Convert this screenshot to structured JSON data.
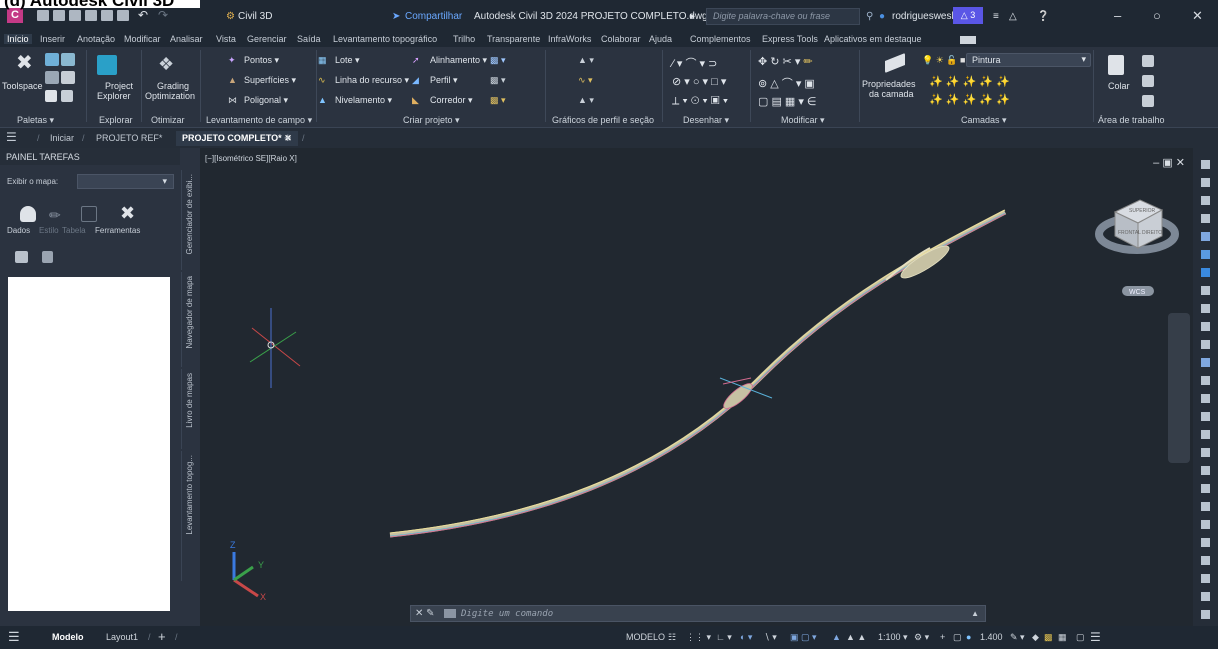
{
  "caption": "(d) Autodesk Civil 3D",
  "titlebar": {
    "workspace": "Civil 3D",
    "share": "Compartilhar",
    "title": "Autodesk Civil 3D 2024   PROJETO COMPLETO.dwg",
    "search_placeholder": "Digite palavra-chave ou frase",
    "user": "rodrigueswesl...",
    "alerts": "3"
  },
  "menu": [
    "Início",
    "Inserir",
    "Anotação",
    "Modificar",
    "Analisar",
    "Vista",
    "Gerenciar",
    "Saída",
    "Levantamento topográfico",
    "Trilho",
    "Transparente",
    "InfraWorks",
    "Colaborar",
    "Ajuda",
    "Complementos",
    "Express Tools",
    "Aplicativos em destaque"
  ],
  "ribbon": {
    "toolspace": "Toolspace",
    "project_explorer": [
      "Project",
      "Explorer"
    ],
    "grading": [
      "Grading",
      "Optimization"
    ],
    "pontos": "Pontos",
    "superficies": "Superfícies",
    "poligonal": "Poligonal",
    "lote": "Lote",
    "linha_recurso": "Linha do recurso",
    "nivelamento": "Nivelamento",
    "alinhamento": "Alinhamento",
    "perfil": "Perfil",
    "corredor": "Corredor",
    "propriedades": [
      "Propriedades",
      "da camada"
    ],
    "layer": "Pintura",
    "colar": "Colar",
    "panels": [
      "Paletas",
      "Explorar",
      "Otimizar",
      "Levantamento de campo",
      "Criar projeto",
      "Gráficos de perfil e seção",
      "Desenhar",
      "Modificar",
      "Camadas",
      "Área de trabalho"
    ]
  },
  "tabs": {
    "start": "Iniciar",
    "ref": "PROJETO REF*",
    "current": "PROJETO COMPLETO*"
  },
  "panel": {
    "title": "PAINEL TAREFAS",
    "map_label": "Exibir o mapa:",
    "tools": [
      "Dados",
      "Estilo",
      "Tabela",
      "Ferramentas"
    ],
    "vtabs": [
      "Gerenciador de exibi...",
      "Navegador de mapa",
      "Livro de mapas",
      "Levantamento topog..."
    ]
  },
  "viewport": {
    "label": "[−][Isométrico SE][Raio X]",
    "wcs": "WCS",
    "cube_faces": [
      "SUPERIOR",
      "FRONTAL",
      "DIREITO"
    ],
    "command_placeholder": "Digite um comando"
  },
  "status": {
    "model": "Modelo",
    "layout": "Layout1",
    "mode": "MODELO",
    "scale": "1:100",
    "zoom": "1.400"
  },
  "colors": {
    "accent": "#5a56e6",
    "logo": "#c43a86",
    "road": "#e8e4c8"
  }
}
